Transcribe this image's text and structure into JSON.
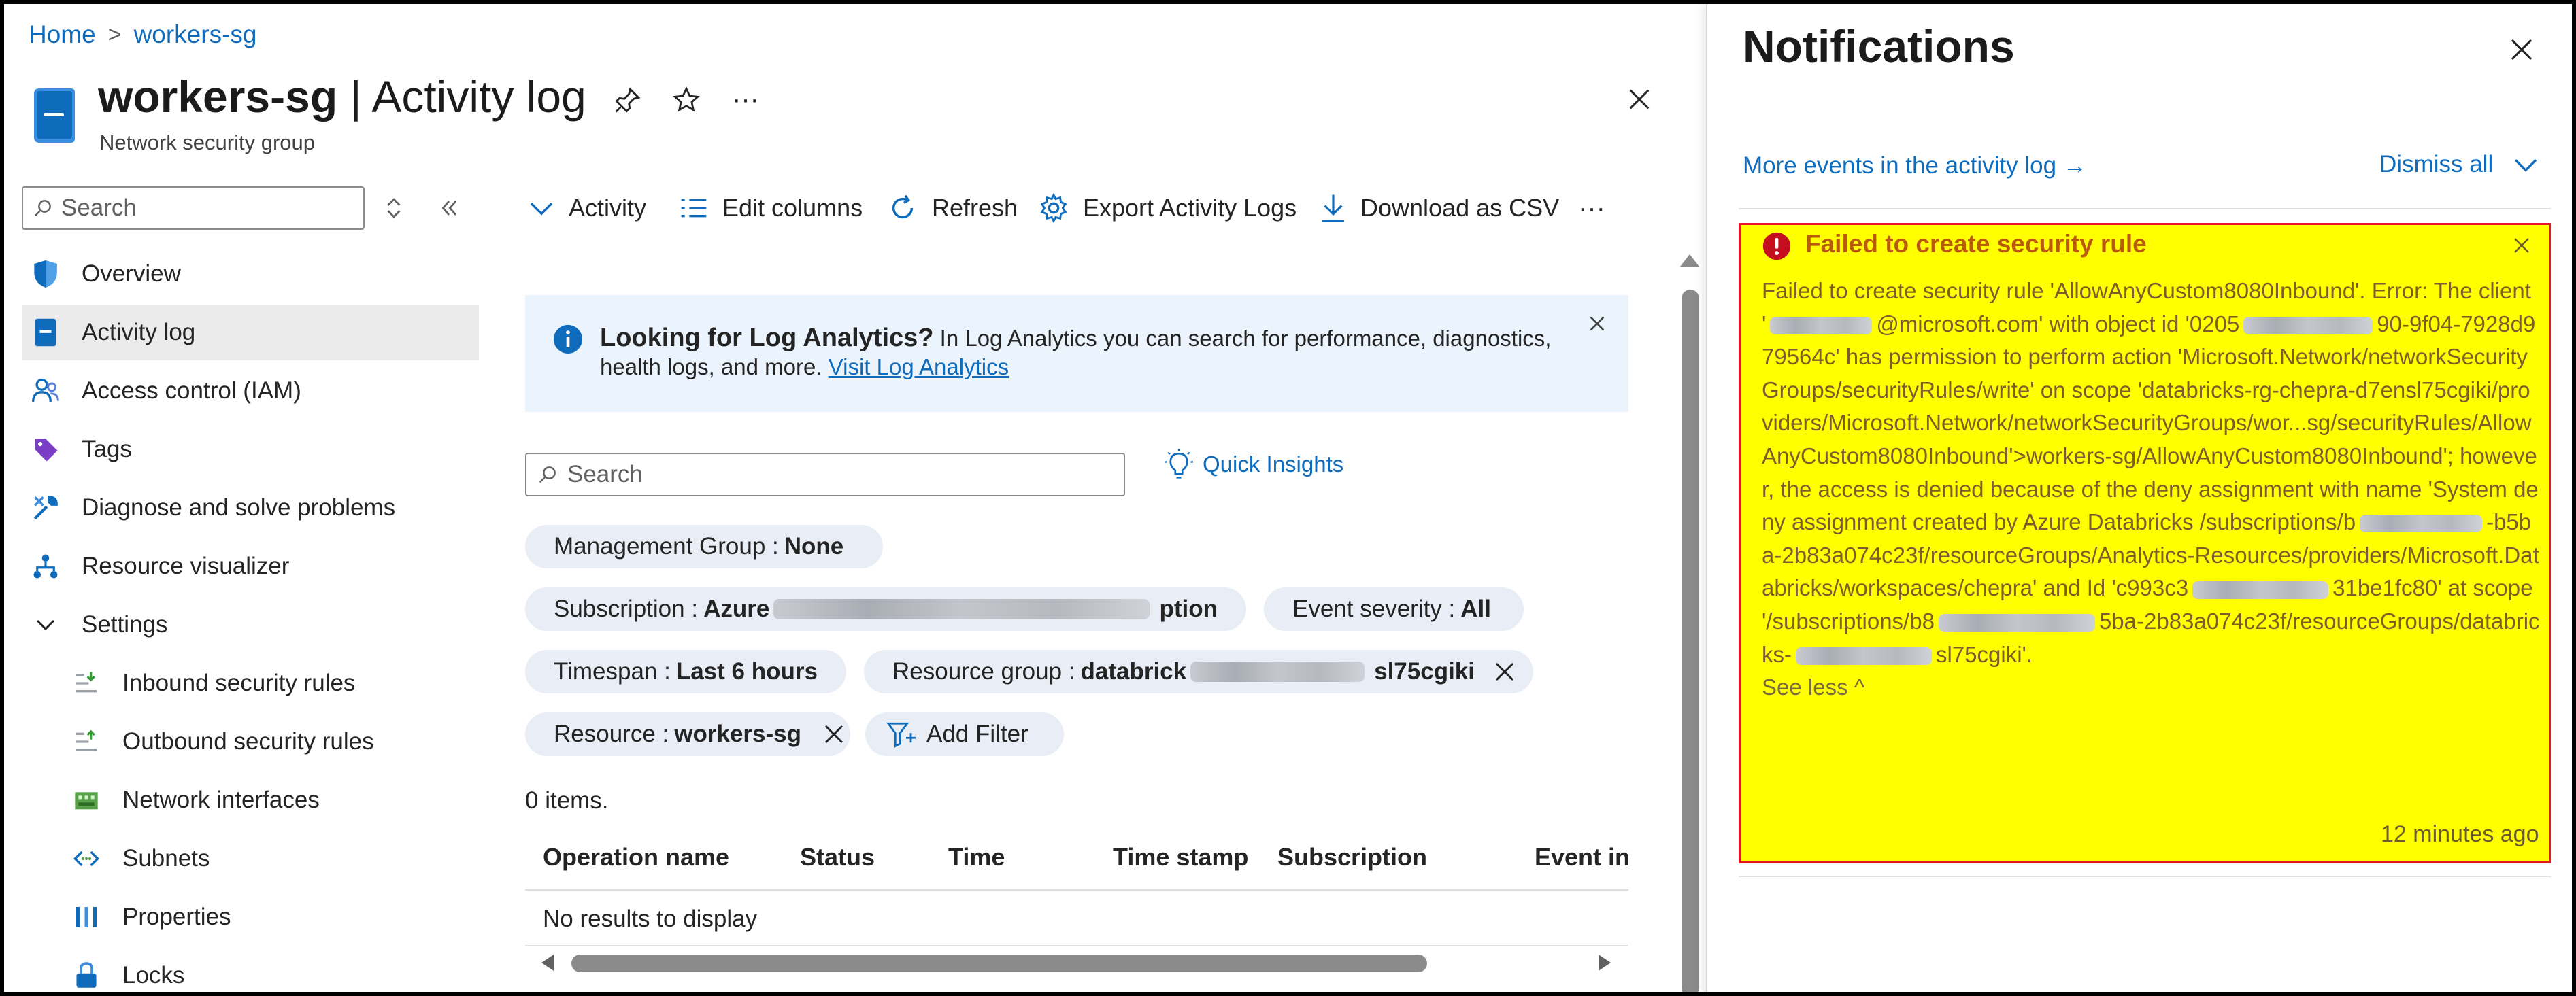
{
  "breadcrumb": {
    "home": "Home",
    "sep": ">",
    "current": "workers-sg"
  },
  "header": {
    "title_name": "workers-sg",
    "title_sep": " | ",
    "title_page": "Activity log",
    "subtitle": "Network security group",
    "more": "···"
  },
  "nav": {
    "search_placeholder": "Search",
    "items": [
      {
        "label": "Overview",
        "icon": "shield-icon"
      },
      {
        "label": "Activity log",
        "icon": "activity-log-icon",
        "active": true
      },
      {
        "label": "Access control (IAM)",
        "icon": "people-icon"
      },
      {
        "label": "Tags",
        "icon": "tag-icon"
      },
      {
        "label": "Diagnose and solve problems",
        "icon": "wrench-icon"
      },
      {
        "label": "Resource visualizer",
        "icon": "hierarchy-icon"
      },
      {
        "label": "Settings",
        "icon": "chevron-down-icon"
      },
      {
        "label": "Inbound security rules",
        "icon": "inbound-rules-icon"
      },
      {
        "label": "Outbound security rules",
        "icon": "outbound-rules-icon"
      },
      {
        "label": "Network interfaces",
        "icon": "network-interface-icon"
      },
      {
        "label": "Subnets",
        "icon": "subnet-icon"
      },
      {
        "label": "Properties",
        "icon": "properties-icon"
      },
      {
        "label": "Locks",
        "icon": "lock-icon"
      }
    ]
  },
  "toolbar": {
    "activity": "Activity",
    "edit_columns": "Edit columns",
    "refresh": "Refresh",
    "export": "Export Activity Logs",
    "download": "Download as CSV",
    "more": "···"
  },
  "info": {
    "heading": "Looking for Log Analytics?",
    "body": " In Log Analytics you can search for performance, diagnostics, health logs, and more. ",
    "link": "Visit Log Analytics"
  },
  "search": {
    "placeholder": "Search",
    "quick_insights": "Quick Insights"
  },
  "filters": {
    "management_group": {
      "label": "Management Group : ",
      "value": "None"
    },
    "subscription": {
      "label": "Subscription : ",
      "value_start": "Azure ",
      "value_end": "ption"
    },
    "event_severity": {
      "label": "Event severity : ",
      "value": "All"
    },
    "timespan": {
      "label": "Timespan : ",
      "value": "Last 6 hours"
    },
    "resource_group": {
      "label": "Resource group : ",
      "value_start": "databrick",
      "value_end": "sl75cgiki"
    },
    "resource": {
      "label": "Resource : ",
      "value": "workers-sg"
    },
    "add_filter": "Add Filter"
  },
  "table": {
    "count": "0 items.",
    "columns": [
      "Operation name",
      "Status",
      "Time",
      "Time stamp",
      "Subscription",
      "Event ini"
    ],
    "empty": "No results to display"
  },
  "notifications": {
    "title": "Notifications",
    "more_events": "More events in the activity log →",
    "dismiss_all": "Dismiss all",
    "card": {
      "title": "Failed to create security rule",
      "body_1": "Failed to create security rule 'AllowAnyCustom8080Inbound'. Error: The client '",
      "body_2": "@microsoft.com' with object id '0205",
      "body_3": "90-9f04-7928d979564c' has permission to perform action 'Microsoft.Network/networkSecurityGroups/securityRules/write' on scope 'databricks-rg-chepra-d7ensl75cgiki/providers/Microsoft.Network/networkSecurityGroups/wor...sg/securityRules/AllowAnyCustom8080Inbound'>workers-sg/AllowAnyCustom8080Inbound'; however, the access is denied because of the deny assignment with name 'System deny assignment created by Azure Databricks /subscriptions/b",
      "body_4": "-b5ba-2b83a074c23f/resourceGroups/Analytics-Resources/providers/Microsoft.Databricks/workspaces/chepra' and Id 'c993c3",
      "body_5": "31be1fc80' at scope '/subscriptions/b8",
      "body_6": "5ba-2b83a074c23f/resourceGroups/databricks-",
      "body_7": "sl75cgiki'.",
      "see_less": "See less ^",
      "time": "12 minutes ago"
    }
  },
  "colors": {
    "accent": "#0f6cbd",
    "highlight": "#ffff00",
    "error": "#c50f1f",
    "pill": "#e9eef6"
  }
}
